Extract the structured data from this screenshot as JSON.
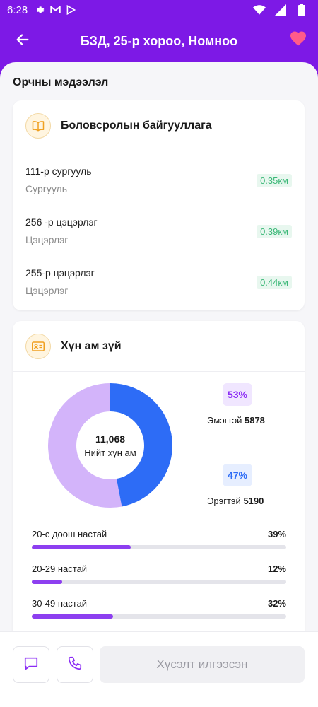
{
  "status_bar": {
    "time": "6:28",
    "icons_left": [
      "gear-icon",
      "gmail-icon",
      "play-store-icon"
    ],
    "icons_right": [
      "wifi-icon",
      "signal-icon",
      "battery-icon"
    ]
  },
  "header": {
    "title": "БЗД, 25-р хороо, Номноо",
    "back_icon": "arrow-left-icon",
    "favorite_icon": "heart-icon",
    "favorite_color": "#ff5b8a"
  },
  "section": {
    "title": "Орчны мэдээлэл"
  },
  "education": {
    "title": "Боловсролын байгууллага",
    "icon": "book-icon",
    "items": [
      {
        "name": "111-р сургууль",
        "type": "Сургууль",
        "distance": "0.35км"
      },
      {
        "name": "256 -р цэцэрлэг",
        "type": "Цэцэрлэг",
        "distance": "0.39км"
      },
      {
        "name": "255-р цэцэрлэг",
        "type": "Цэцэрлэг",
        "distance": "0.44км"
      }
    ]
  },
  "demographics": {
    "title": "Хүн ам зүй",
    "icon": "id-card-icon",
    "total": "11,068",
    "total_label": "Нийт хүн ам",
    "female": {
      "percent": "53%",
      "label": "Эмэгтэй",
      "count": "5878",
      "color": "#d3b4fa",
      "value": 53
    },
    "male": {
      "percent": "47%",
      "label": "Эрэгтэй",
      "count": "5190",
      "color": "#2d6cf6",
      "value": 47
    },
    "age_groups": [
      {
        "label": "20-с доош настай",
        "percent": "39%",
        "value": 39
      },
      {
        "label": "20-29 настай",
        "percent": "12%",
        "value": 12
      },
      {
        "label": "30-49 настай",
        "percent": "32%",
        "value": 32
      }
    ]
  },
  "bottom": {
    "chat_icon": "chat-icon",
    "call_icon": "phone-icon",
    "request_label": "Хүсэлт илгээсэн"
  },
  "colors": {
    "brand": "#7d19e6",
    "accent_bar": "#8d3ff0",
    "distance_green": "#3cb878"
  }
}
